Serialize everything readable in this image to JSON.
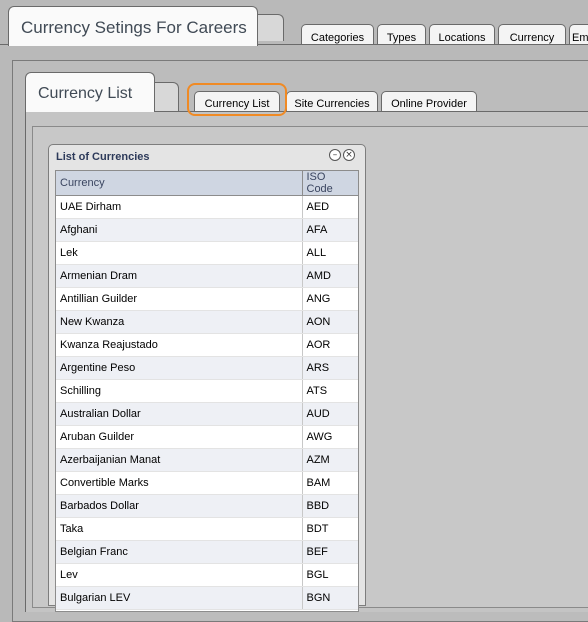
{
  "page_title": "Currency Setings For Careers",
  "top_tabs": [
    "Categories",
    "Types",
    "Locations",
    "Currency",
    "Em"
  ],
  "sub_title": "Currency List",
  "sub_tabs": [
    "Currency List",
    "Site Currencies",
    "Online Provider"
  ],
  "panel": {
    "title": "List of Currencies",
    "minimize_icon": "minus-circle-icon",
    "close_icon": "close-circle-icon",
    "columns": [
      "Currency",
      "ISO Code"
    ],
    "rows": [
      [
        "UAE Dirham",
        "AED"
      ],
      [
        "Afghani",
        "AFA"
      ],
      [
        "Lek",
        "ALL"
      ],
      [
        "Armenian Dram",
        "AMD"
      ],
      [
        "Antillian Guilder",
        "ANG"
      ],
      [
        "New Kwanza",
        "AON"
      ],
      [
        "Kwanza Reajustado",
        "AOR"
      ],
      [
        "Argentine Peso",
        "ARS"
      ],
      [
        "Schilling",
        "ATS"
      ],
      [
        "Australian Dollar",
        "AUD"
      ],
      [
        "Aruban Guilder",
        "AWG"
      ],
      [
        "Azerbaijanian Manat",
        "AZM"
      ],
      [
        "Convertible Marks",
        "BAM"
      ],
      [
        "Barbados Dollar",
        "BBD"
      ],
      [
        "Taka",
        "BDT"
      ],
      [
        "Belgian Franc",
        "BEF"
      ],
      [
        "Lev",
        "BGL"
      ],
      [
        "Bulgarian LEV",
        "BGN"
      ]
    ]
  },
  "colors": {
    "highlight": "#f08a24",
    "header_bg": "#cfd6e2",
    "title_text": "#404a55"
  }
}
